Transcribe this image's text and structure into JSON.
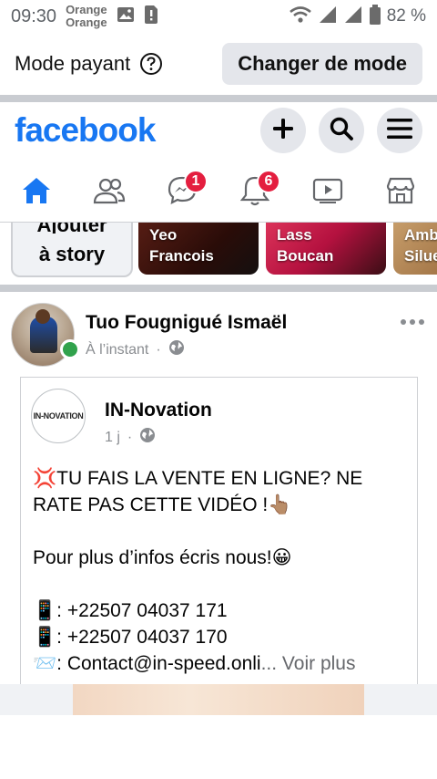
{
  "status_bar": {
    "time": "09:30",
    "carrier_line1": "Orange",
    "carrier_line2": "Orange",
    "battery": "82 %"
  },
  "mode_bar": {
    "label": "Mode payant",
    "button": "Changer de mode"
  },
  "header": {
    "logo": "facebook"
  },
  "tabs": {
    "messenger_badge": "1",
    "notifications_badge": "6"
  },
  "stories": {
    "create_line1": "Ajouter",
    "create_line2": "à story",
    "cards": [
      {
        "line1": "Yeo",
        "line2": "Francois"
      },
      {
        "line1": "Lass",
        "line2": "Boucan"
      },
      {
        "line1": "Amb",
        "line2": "Silue"
      }
    ]
  },
  "post": {
    "author": "Tuo Fougnigué Ismaël",
    "time": "À l’instant",
    "shared": {
      "page_name": "IN-Novation",
      "page_logo": "IN-NOVATION",
      "time": "1 j",
      "lines": [
        "💢TU FAIS LA VENTE EN LIGNE? NE",
        "RATE PAS CETTE VIDÉO !👆🏽",
        "",
        "Pour plus d’infos écris nous!😀",
        "",
        "📱: +22507 04037 171",
        "📱: +22507 04037 170",
        "📨: Contact@in-speed.onli"
      ],
      "see_more": "... Voir plus"
    }
  }
}
